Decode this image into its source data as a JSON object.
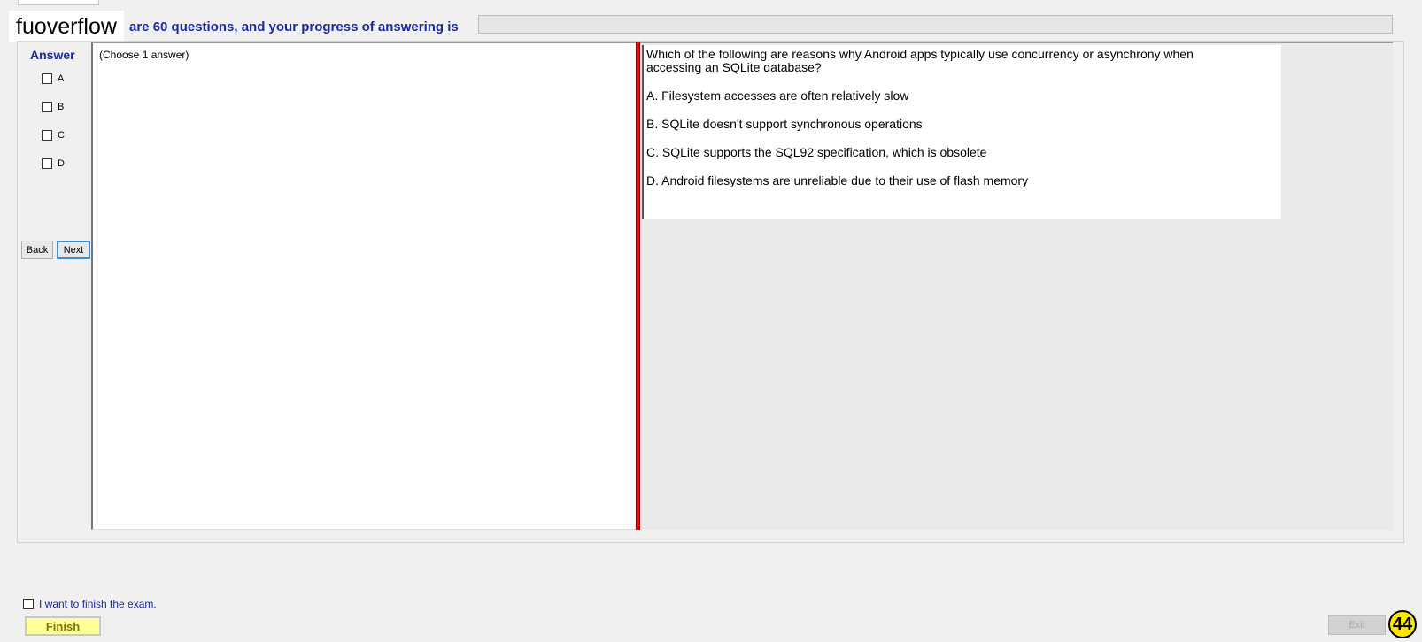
{
  "header": {
    "watermark": "fuoverflow",
    "progress_text": "are 60 questions, and your progress of answering is",
    "progress_fraction": 0
  },
  "answer_panel": {
    "title": "Answer",
    "options": [
      {
        "label": "A",
        "checked": false
      },
      {
        "label": "B",
        "checked": false
      },
      {
        "label": "C",
        "checked": false
      },
      {
        "label": "D",
        "checked": false
      }
    ],
    "back_label": "Back",
    "next_label": "Next",
    "choose_text": "(Choose 1 answer)"
  },
  "question": {
    "line1": "Which of the following are reasons why Android apps typically use concurrency or asynchrony when",
    "line2": "accessing an SQLite database?",
    "options": [
      "A.  Filesystem accesses are often relatively slow",
      "B.  SQLite doesn't support synchronous operations",
      "C.  SQLite supports the SQL92 specification, which is obsolete",
      "D.  Android filesystems are unreliable due to their use of flash memory"
    ]
  },
  "footer": {
    "finish_checkbox_label": "I want to finish the exam.",
    "finish_label": "Finish",
    "exit_label": "Exit",
    "page_number": "44"
  },
  "colors": {
    "accent_text": "#1a2aa0",
    "splitter": "#e8141a",
    "finish_bg": "#ffff99",
    "badge": "#ffe800"
  }
}
